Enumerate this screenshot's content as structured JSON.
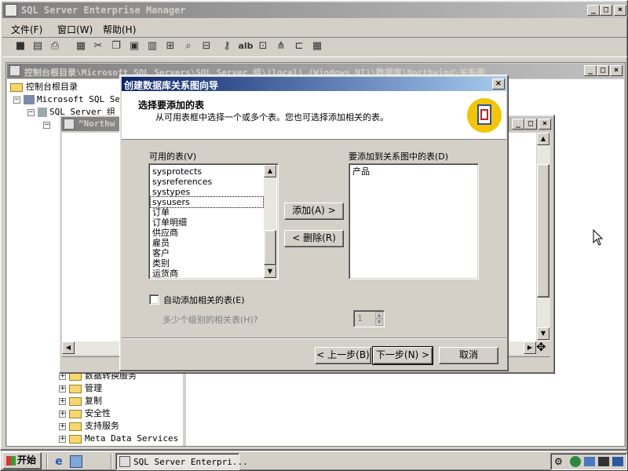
{
  "main_window": {
    "title": "SQL Server Enterprise Manager",
    "menu": [
      "文件(F)",
      "窗口(W)",
      "帮助(H)"
    ],
    "toolbar_icons": [
      "save-icon",
      "properties-icon",
      "print-icon",
      "new-icon",
      "cut-icon",
      "copy-icon",
      "paste-icon",
      "new-table-icon",
      "add-related-icon",
      "zoom-icon",
      "autoarrange-icon",
      "key-icon",
      "text-annotation-icon",
      "layout-icon",
      "relationship-icon",
      "arrange-icon",
      "grid-icon"
    ]
  },
  "child_window": {
    "title": "控制台根目录\\Microsoft SQL Servers\\SQL Server 组\\(local) (Windows NT)\\数据库\\Northwind\\关系图"
  },
  "tree": {
    "root": "控制台根目录",
    "n1": "Microsoft SQL Ser",
    "n2": "SQL Server 组",
    "bottom_items": [
      "数据转换服务",
      "管理",
      "复制",
      "安全性",
      "支持服务",
      "Meta Data Services"
    ]
  },
  "diagram_window": {
    "title": "“Northw"
  },
  "wizard": {
    "title": "创建数据库关系图向导",
    "header_title": "选择要添加的表",
    "header_desc": "从可用表框中选择一个或多个表。您也可选择添加相关的表。",
    "available_label": "可用的表(V)",
    "available_tables": [
      "sysprotects",
      "sysreferences",
      "systypes",
      "sysusers",
      "订单",
      "订单明细",
      "供应商",
      "雇员",
      "客户",
      "类别",
      "运货商"
    ],
    "selected_label": "要添加到关系图中的表(D)",
    "selected_tables": [
      "产品"
    ],
    "add_button": "添加(A) >",
    "remove_button": "< 删除(R)",
    "auto_add_checkbox": "自动添加相关的表(E)",
    "levels_label": "多少个级别的相关表(H)?",
    "levels_value": "1",
    "back_button": "< 上一步(B)",
    "next_button": "下一步(N) >",
    "cancel_button": "取消"
  },
  "taskbar": {
    "start": "开始",
    "task": "SQL Server Enterpri..."
  }
}
